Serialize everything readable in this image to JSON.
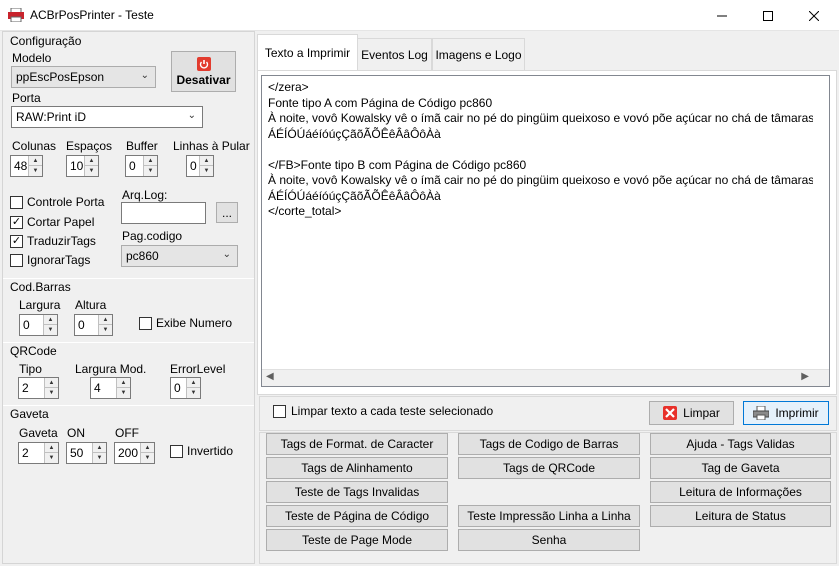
{
  "window": {
    "title": "ACBrPosPrinter - Teste",
    "minimize_icon": "minimize-icon",
    "maximize_icon": "maximize-icon",
    "close_icon": "close-icon"
  },
  "config": {
    "group_title": "Configuração",
    "modelo_label": "Modelo",
    "modelo_value": "ppEscPosEpson",
    "desativar_label": "Desativar",
    "porta_label": "Porta",
    "porta_value": "RAW:Print iD",
    "colunas_label": "Colunas",
    "colunas_value": "48",
    "espacos_label": "Espaços",
    "espacos_value": "10",
    "buffer_label": "Buffer",
    "buffer_value": "0",
    "linhas_label": "Linhas à Pular",
    "linhas_value": "0",
    "controle_porta_label": "Controle Porta",
    "cortar_papel_label": "Cortar Papel",
    "traduzir_tags_label": "TraduzirTags",
    "ignorar_tags_label": "IgnorarTags",
    "arqlog_label": "Arq.Log:",
    "arqlog_value": "",
    "arqlog_btn": "...",
    "pagcodigo_label": "Pag.codigo",
    "pagcodigo_value": "pc860"
  },
  "codbarras": {
    "group_title": "Cod.Barras",
    "largura_label": "Largura",
    "largura_value": "0",
    "altura_label": "Altura",
    "altura_value": "0",
    "exibe_numero_label": "Exibe Numero"
  },
  "qrcode": {
    "group_title": "QRCode",
    "tipo_label": "Tipo",
    "tipo_value": "2",
    "largura_mod_label": "Largura Mod.",
    "largura_mod_value": "4",
    "error_level_label": "ErrorLevel",
    "error_level_value": "0"
  },
  "gaveta": {
    "group_title": "Gaveta",
    "gaveta_label": "Gaveta",
    "gaveta_value": "2",
    "on_label": "ON",
    "on_value": "50",
    "off_label": "OFF",
    "off_value": "200",
    "invertido_label": "Invertido"
  },
  "tabs": [
    {
      "label": "Texto a Imprimir"
    },
    {
      "label": "Eventos Log"
    },
    {
      "label": "Imagens e Logo"
    }
  ],
  "memo": {
    "lines": [
      "</zera>",
      "Fonte tipo A com Página de Código pc860",
      "À noite, vovô Kowalsky vê o ímã cair no pé do pingüim queixoso e vovó põe açúcar no chá de tâmaras do jabuti feliz.",
      "ÁÉÍÓÚáéíóúçÇãõÃÕÊêÂâÔôÀà",
      "",
      "</FB>Fonte tipo B com Página de Código pc860",
      "À noite, vovô Kowalsky vê o ímã cair no pé do pingüim queixoso e vovó põe açúcar no chá de tâmaras do jabuti feliz.",
      "ÁÉÍÓÚáéíóúçÇãõÃÕÊêÂâÔôÀà",
      "</corte_total>"
    ]
  },
  "actions": {
    "limpar_texto_label": "Limpar texto a cada teste selecionado",
    "limpar_label": "Limpar",
    "imprimir_label": "Imprimir"
  },
  "buttons": {
    "col1": [
      "Tags de Format. de Caracter",
      "Tags de Alinhamento",
      "Teste de Tags Invalidas",
      "Teste de Página de Código",
      "Teste de Page Mode"
    ],
    "col2": [
      "Tags de Codigo de Barras",
      "Tags de QRCode",
      "Teste Impressão Linha a Linha",
      "Senha"
    ],
    "col3": [
      "Ajuda - Tags Validas",
      "Tag de Gaveta",
      "Leitura de Informações",
      "Leitura de Status"
    ]
  }
}
